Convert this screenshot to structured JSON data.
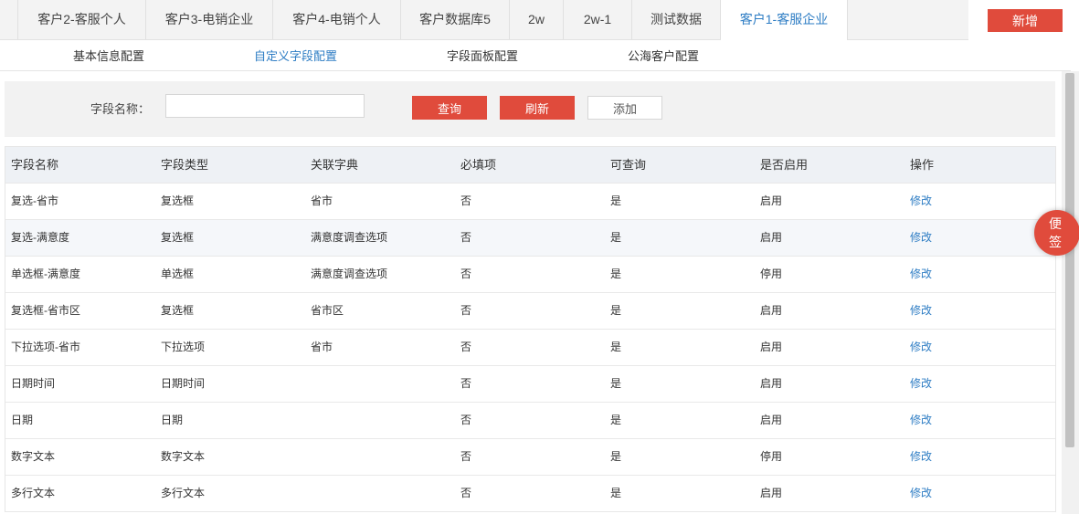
{
  "tabs": [
    {
      "label": "客户2-客服个人"
    },
    {
      "label": "客户3-电销企业"
    },
    {
      "label": "客户4-电销个人"
    },
    {
      "label": "客户数据库5"
    },
    {
      "label": "2w"
    },
    {
      "label": "2w-1"
    },
    {
      "label": "测试数据"
    },
    {
      "label": "客户1-客服企业",
      "active": true
    }
  ],
  "toolbar": {
    "add_label": "新增"
  },
  "subtabs": [
    {
      "label": "基本信息配置"
    },
    {
      "label": "自定义字段配置",
      "active": true
    },
    {
      "label": "字段面板配置"
    },
    {
      "label": "公海客户配置"
    }
  ],
  "search": {
    "label": "字段名称：",
    "value": "",
    "placeholder": "",
    "query_label": "查询",
    "refresh_label": "刷新",
    "add_label": "添加"
  },
  "table": {
    "headers": [
      "字段名称",
      "字段类型",
      "关联字典",
      "必填项",
      "可查询",
      "是否启用",
      "操作"
    ],
    "rows": [
      [
        "复选-省市",
        "复选框",
        "省市",
        "否",
        "是",
        "启用",
        "修改"
      ],
      [
        "复选-满意度",
        "复选框",
        "满意度调查选项",
        "否",
        "是",
        "启用",
        "修改"
      ],
      [
        "单选框-满意度",
        "单选框",
        "满意度调查选项",
        "否",
        "是",
        "停用",
        "修改"
      ],
      [
        "复选框-省市区",
        "复选框",
        "省市区",
        "否",
        "是",
        "启用",
        "修改"
      ],
      [
        "下拉选项-省市",
        "下拉选项",
        "省市",
        "否",
        "是",
        "启用",
        "修改"
      ],
      [
        "日期时间",
        "日期时间",
        "",
        "否",
        "是",
        "启用",
        "修改"
      ],
      [
        "日期",
        "日期",
        "",
        "否",
        "是",
        "启用",
        "修改"
      ],
      [
        "数字文本",
        "数字文本",
        "",
        "否",
        "是",
        "停用",
        "修改"
      ],
      [
        "多行文本",
        "多行文本",
        "",
        "否",
        "是",
        "启用",
        "修改"
      ]
    ]
  },
  "note": {
    "line1": "便",
    "line2": "签"
  },
  "colors": {
    "accent_red": "#e04b3c",
    "link_blue": "#2e7dc4"
  }
}
